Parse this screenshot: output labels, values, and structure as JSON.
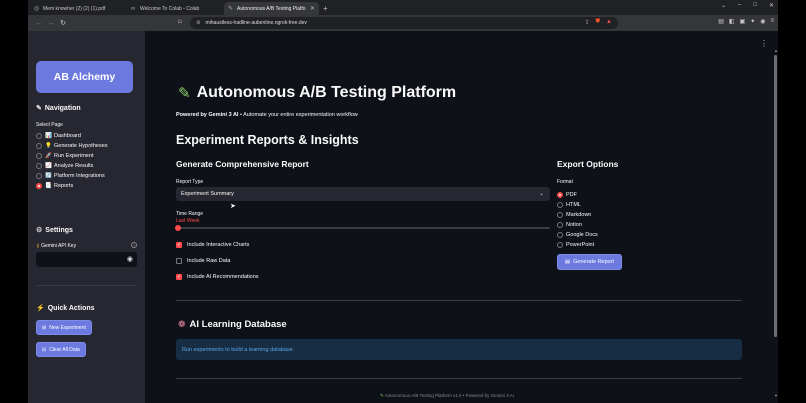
{
  "browser": {
    "tabs": [
      {
        "title": "Mem knowher (2) (2) (1).pdf",
        "active": false
      },
      {
        "title": "Welcome To Colab - Colab",
        "active": false
      },
      {
        "title": "Autonomous A/B Testing Platfo",
        "active": true
      }
    ],
    "url": "mihaustless-hadline-aubentine.ngrok-free.dev"
  },
  "sidebar": {
    "brand": "AB Alchemy",
    "navigation_heading": "Navigation",
    "select_page_label": "Select Page",
    "pages": [
      {
        "icon": "📊",
        "label": "Dashboard",
        "selected": false
      },
      {
        "icon": "💡",
        "label": "Generate Hypotheses",
        "selected": false
      },
      {
        "icon": "🚀",
        "label": "Run Experiment",
        "selected": false
      },
      {
        "icon": "📈",
        "label": "Analyze Results",
        "selected": false
      },
      {
        "icon": "🔄",
        "label": "Platform Integrations",
        "selected": false
      },
      {
        "icon": "📑",
        "label": "Reports",
        "selected": true
      }
    ],
    "settings_heading": "Settings",
    "api_key_label": "Gemini API Key",
    "quick_actions_heading": "Quick Actions",
    "new_experiment_label": "New Experiment",
    "clear_data_label": "Clear All Data"
  },
  "main": {
    "title": "Autonomous A/B Testing Platform",
    "subtitle_bold": "Powered by Gemini 3 AI",
    "subtitle_rest": " • Automate your entire experimentation workflow",
    "section_title": "Experiment Reports & Insights",
    "report_heading": "Generate Comprehensive Report",
    "report_type_label": "Report Type",
    "report_type_value": "Experiment Summary",
    "time_range_label": "Time Range",
    "time_range_value": "Last Week",
    "checks": [
      {
        "label": "Include Interactive Charts",
        "checked": true
      },
      {
        "label": "Include Raw Data",
        "checked": false
      },
      {
        "label": "Include AI Recommendations",
        "checked": true
      }
    ],
    "export_heading": "Export Options",
    "format_label": "Format",
    "formats": [
      {
        "label": "PDF",
        "selected": true
      },
      {
        "label": "HTML",
        "selected": false
      },
      {
        "label": "Markdown",
        "selected": false
      },
      {
        "label": "Notion",
        "selected": false
      },
      {
        "label": "Google Docs",
        "selected": false
      },
      {
        "label": "PowerPoint",
        "selected": false
      }
    ],
    "generate_button": "Generate Report",
    "db_heading": "AI Learning Database",
    "db_info": "Run experiments to build a learning database.",
    "footer": "Autonomous A/B Testing Platform v1.0 • Powered by Gemini 3 AI"
  },
  "colors": {
    "accent": "#6c7ae0",
    "selected": "#ff4b4b",
    "info_bg": "#172d43",
    "info_text": "#5aa7e8"
  }
}
